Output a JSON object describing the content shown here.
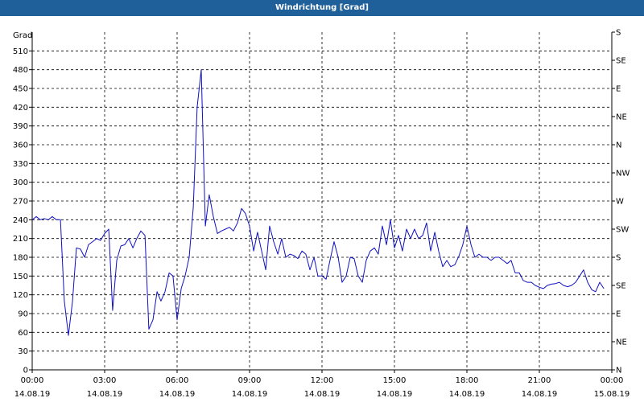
{
  "window": {
    "title": "Windrichtung [Grad]"
  },
  "colors": {
    "titlebar": "#1f5f9a",
    "line": "#1010c0",
    "grid": "#000000",
    "axis": "#000000"
  },
  "chart_data": {
    "type": "line",
    "title": "Windrichtung [Grad]",
    "ylabel": "Grad",
    "xlabel": "",
    "ylim": [
      0,
      540
    ],
    "xlim": [
      0,
      24
    ],
    "grid": true,
    "legend": "none",
    "y_ticks": [
      0,
      30,
      60,
      90,
      120,
      150,
      180,
      210,
      240,
      270,
      300,
      330,
      360,
      390,
      420,
      450,
      480,
      510
    ],
    "x_ticks": [
      {
        "value": 0,
        "time": "00:00",
        "date": "14.08.19"
      },
      {
        "value": 3,
        "time": "03:00",
        "date": "14.08.19"
      },
      {
        "value": 6,
        "time": "06:00",
        "date": "14.08.19"
      },
      {
        "value": 9,
        "time": "09:00",
        "date": "14.08.19"
      },
      {
        "value": 12,
        "time": "12:00",
        "date": "14.08.19"
      },
      {
        "value": 15,
        "time": "15:00",
        "date": "14.08.19"
      },
      {
        "value": 18,
        "time": "18:00",
        "date": "14.08.19"
      },
      {
        "value": 21,
        "time": "21:00",
        "date": "14.08.19"
      },
      {
        "value": 24,
        "time": "00:00",
        "date": "15.08.19"
      }
    ],
    "y2_ticks": [
      {
        "value": 0,
        "label": "N"
      },
      {
        "value": 45,
        "label": "NE"
      },
      {
        "value": 90,
        "label": "E"
      },
      {
        "value": 135,
        "label": "SE"
      },
      {
        "value": 180,
        "label": "S"
      },
      {
        "value": 225,
        "label": "SW"
      },
      {
        "value": 270,
        "label": "W"
      },
      {
        "value": 315,
        "label": "NW"
      },
      {
        "value": 360,
        "label": "N"
      },
      {
        "value": 405,
        "label": "NE"
      },
      {
        "value": 450,
        "label": "E"
      },
      {
        "value": 495,
        "label": "SE"
      },
      {
        "value": 540,
        "label": "S"
      }
    ],
    "series": [
      {
        "x": [
          0,
          0.17,
          0.33,
          0.5,
          0.67,
          0.83,
          1.0,
          1.17,
          1.33,
          1.5,
          1.67,
          1.83,
          2.0,
          2.17,
          2.33,
          2.5,
          2.67,
          2.83,
          3.0,
          3.17,
          3.33,
          3.5,
          3.67,
          3.83,
          4.0,
          4.17,
          4.33,
          4.5,
          4.67,
          4.83,
          5.0,
          5.17,
          5.33,
          5.5,
          5.67,
          5.83,
          6.0,
          6.17,
          6.33,
          6.5,
          6.67,
          6.83,
          7.0,
          7.17,
          7.33,
          7.5,
          7.67,
          7.83,
          8.0,
          8.17,
          8.33,
          8.5,
          8.67,
          8.83,
          9.0,
          9.17,
          9.33,
          9.5,
          9.67,
          9.83,
          10.0,
          10.17,
          10.33,
          10.5,
          10.67,
          10.83,
          11.0,
          11.17,
          11.33,
          11.5,
          11.67,
          11.83,
          12.0,
          12.17,
          12.33,
          12.5,
          12.67,
          12.83,
          13.0,
          13.17,
          13.33,
          13.5,
          13.67,
          13.83,
          14.0,
          14.17,
          14.33,
          14.5,
          14.67,
          14.83,
          15.0,
          15.17,
          15.33,
          15.5,
          15.67,
          15.83,
          16.0,
          16.17,
          16.33,
          16.5,
          16.67,
          16.83,
          17.0,
          17.17,
          17.33,
          17.5,
          17.67,
          17.83,
          18.0,
          18.17,
          18.33,
          18.5,
          18.67,
          18.83,
          19.0,
          19.17,
          19.33,
          19.5,
          19.67,
          19.83,
          20.0,
          20.17,
          20.33,
          20.5,
          20.67,
          20.83,
          21.0,
          21.17,
          21.33,
          21.5,
          21.67,
          21.83,
          22.0,
          22.17,
          22.33,
          22.5,
          22.67,
          22.83,
          23.0,
          23.17,
          23.33,
          23.5,
          23.67
        ],
        "values": [
          240,
          245,
          240,
          242,
          240,
          245,
          240,
          240,
          110,
          55,
          110,
          195,
          193,
          180,
          200,
          205,
          210,
          207,
          218,
          225,
          95,
          175,
          198,
          200,
          210,
          195,
          210,
          222,
          215,
          65,
          80,
          125,
          110,
          125,
          155,
          150,
          80,
          130,
          150,
          180,
          260,
          420,
          480,
          230,
          280,
          245,
          218,
          222,
          225,
          228,
          222,
          235,
          258,
          250,
          230,
          190,
          220,
          190,
          160,
          230,
          205,
          185,
          210,
          180,
          185,
          183,
          178,
          190,
          185,
          160,
          180,
          150,
          150,
          145,
          175,
          205,
          180,
          140,
          150,
          180,
          178,
          150,
          140,
          175,
          190,
          195,
          185,
          230,
          200,
          240,
          195,
          215,
          190,
          225,
          210,
          225,
          210,
          215,
          235,
          190,
          220,
          190,
          165,
          175,
          165,
          168,
          182,
          200,
          230,
          200,
          180,
          185,
          180,
          180,
          175,
          180,
          180,
          175,
          170,
          175,
          155,
          155,
          143,
          140,
          140,
          135,
          132,
          130,
          135,
          137,
          138,
          140,
          135,
          133,
          135,
          140,
          150,
          160,
          140,
          128,
          125,
          140,
          130
        ]
      }
    ]
  }
}
